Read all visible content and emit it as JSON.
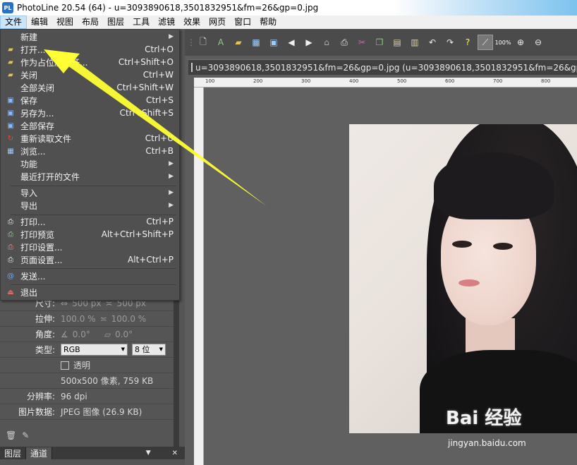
{
  "title_bar": {
    "app_title": "PhotoLine 20.54 (64) - u=3093890618,3501832951&fm=26&gp=0.jpg",
    "app_icon_text": "PL"
  },
  "menu_bar": [
    "文件",
    "编辑",
    "视图",
    "布局",
    "图层",
    "工具",
    "滤镜",
    "效果",
    "网页",
    "窗口",
    "帮助"
  ],
  "file_menu": [
    {
      "label": "新建",
      "shortcut": "",
      "submenu": true,
      "icon": ""
    },
    {
      "label": "打开...",
      "shortcut": "Ctrl+O",
      "submenu": false,
      "icon": "open-folder-icon"
    },
    {
      "label": "作为占位层打开...",
      "shortcut": "Ctrl+Shift+O",
      "submenu": false,
      "icon": "open-placeholder-icon"
    },
    {
      "label": "关闭",
      "shortcut": "Ctrl+W",
      "submenu": false,
      "icon": "close-file-icon"
    },
    {
      "label": "全部关闭",
      "shortcut": "Ctrl+Shift+W",
      "submenu": false,
      "icon": ""
    },
    {
      "label": "保存",
      "shortcut": "Ctrl+S",
      "submenu": false,
      "icon": "save-icon"
    },
    {
      "label": "另存为...",
      "shortcut": "Ctrl+Shift+S",
      "submenu": false,
      "icon": "save-as-icon"
    },
    {
      "label": "全部保存",
      "shortcut": "",
      "submenu": false,
      "icon": "save-all-icon"
    },
    {
      "label": "重新读取文件",
      "shortcut": "Ctrl+U",
      "submenu": false,
      "icon": "reload-icon"
    },
    {
      "label": "浏览...",
      "shortcut": "Ctrl+B",
      "submenu": false,
      "icon": "browse-icon"
    },
    {
      "label": "功能",
      "shortcut": "",
      "submenu": true,
      "icon": ""
    },
    {
      "label": "最近打开的文件",
      "shortcut": "",
      "submenu": true,
      "icon": ""
    },
    {
      "label": "导入",
      "shortcut": "",
      "submenu": true,
      "icon": ""
    },
    {
      "label": "导出",
      "shortcut": "",
      "submenu": true,
      "icon": ""
    },
    {
      "label": "打印...",
      "shortcut": "Ctrl+P",
      "submenu": false,
      "icon": "print-icon"
    },
    {
      "label": "打印预览",
      "shortcut": "Alt+Ctrl+Shift+P",
      "submenu": false,
      "icon": "print-preview-icon"
    },
    {
      "label": "打印设置...",
      "shortcut": "",
      "submenu": false,
      "icon": "print-settings-icon"
    },
    {
      "label": "页面设置...",
      "shortcut": "Alt+Ctrl+P",
      "submenu": false,
      "icon": "page-setup-icon"
    },
    {
      "label": "发送...",
      "shortcut": "",
      "submenu": false,
      "icon": "send-icon"
    },
    {
      "label": "退出",
      "shortcut": "",
      "submenu": false,
      "icon": "exit-icon"
    }
  ],
  "properties": {
    "size_label": "尺寸:",
    "size_w": "500 px",
    "size_h": "500 px",
    "stretch_label": "拉伸:",
    "stretch_w": "100.0 %",
    "stretch_h": "100.0 %",
    "angle_label": "角度:",
    "angle_a": "0.0°",
    "angle_b": "0.0°",
    "type_label": "类型:",
    "type_value": "RGB",
    "bits_value": "8 位",
    "transparent_label": "透明",
    "info": "500x500 像素, 759 KB",
    "resolution_label": "分辨率:",
    "resolution_value": "96 dpi",
    "image_data_label": "图片数据:",
    "image_data_value": "JPEG 图像 (26.9 KB)"
  },
  "panel_tabs": [
    "图层",
    "通道"
  ],
  "toolbar": {
    "zoom_label": "100%"
  },
  "document": {
    "tab_title": "u=3093890618,3501832951&fm=26&gp=0.jpg (u=3093890618,3501832951&fm=26&gp=0.jpg)",
    "ruler_ticks": [
      "100",
      "200",
      "300",
      "400",
      "500",
      "600",
      "700",
      "800"
    ]
  },
  "watermark": {
    "brand": "Bai 经验",
    "url": "jingyan.baidu.com"
  },
  "colors": {
    "accent_arrow": "#ffff33",
    "menu_bg": "#505050"
  }
}
